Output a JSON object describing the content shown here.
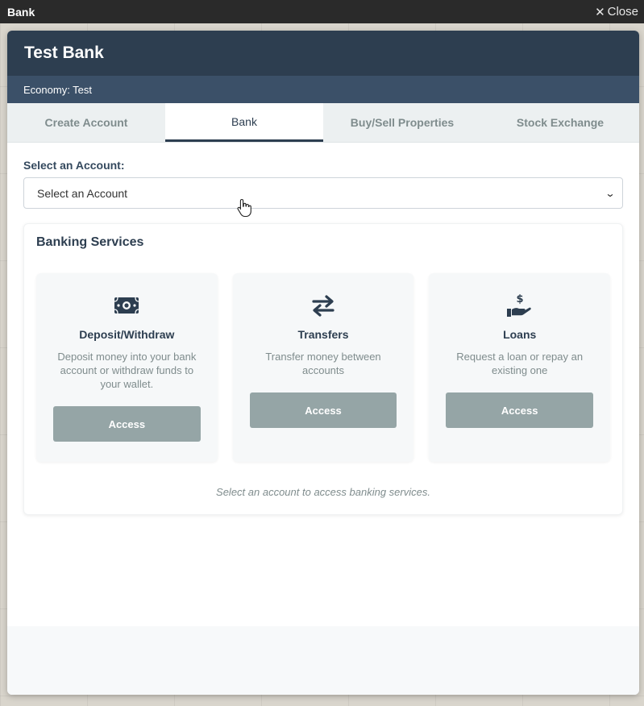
{
  "window": {
    "title": "Bank",
    "close_label": "Close"
  },
  "dialog": {
    "title": "Test Bank",
    "economy": "Economy: Test"
  },
  "tabs": [
    {
      "label": "Create Account",
      "active": false
    },
    {
      "label": "Bank",
      "active": true
    },
    {
      "label": "Buy/Sell Properties",
      "active": false
    },
    {
      "label": "Stock Exchange",
      "active": false
    }
  ],
  "account": {
    "label": "Select an Account:",
    "selected": "Select an Account"
  },
  "services": {
    "title": "Banking Services",
    "items": [
      {
        "icon": "money-bill-icon",
        "name": "Deposit/Withdraw",
        "description": "Deposit money into your bank account or withdraw funds to your wallet.",
        "button": "Access"
      },
      {
        "icon": "exchange-arrows-icon",
        "name": "Transfers",
        "description": "Transfer money between accounts",
        "button": "Access"
      },
      {
        "icon": "hand-dollar-icon",
        "name": "Loans",
        "description": "Request a loan or repay an existing one",
        "button": "Access"
      }
    ],
    "note": "Select an account to access banking services."
  },
  "colors": {
    "header": "#2d3e50",
    "subheader": "#3b5068",
    "button": "#95a5a6",
    "muted_text": "#7f8c8d"
  }
}
